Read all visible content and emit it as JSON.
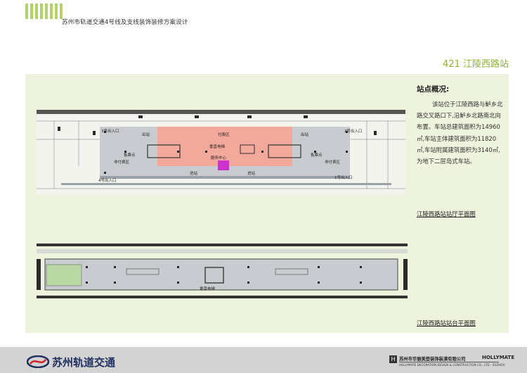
{
  "header": {
    "title": "苏州市轨道交通4号线及支线装饰装修方案设计"
  },
  "station": {
    "heading": "421  江陵西路站",
    "section_title": "站点概况:",
    "description": "该站位于江陵西路与鲈乡北路交叉路口下,沿鲈乡北路南北向布置。车站总建筑面积为14960㎡,车站主体建筑面积为11820㎡,车站附属建筑面积为3140㎡,为地下二层岛式车站。"
  },
  "plans": {
    "hall_caption": "江陵西路站站厅平面图",
    "platform_caption": "江陵西路站站台平面图",
    "hall_labels": {
      "exit3": "3号出入口",
      "exit2": "2号出入口",
      "exit4": "4号出入口",
      "exit1": "1号出入口",
      "out_left": "出站",
      "out_right": "出站",
      "paid": "付费区",
      "unpaid_left": "非付费区",
      "unpaid_right": "非付费区",
      "ticket_left": "售票点",
      "ticket_right": "售票点",
      "elevator": "垂直电梯",
      "service": "服务中心",
      "in_left": "进站",
      "in_right": "进站"
    },
    "platform_labels": {
      "elevator": "垂直电梯"
    },
    "colors": {
      "paid": "#f2a89a",
      "service": "#cc33cc",
      "floor": "#c8cbd0",
      "wall": "#2a2a2a"
    }
  },
  "footer": {
    "logo_text": "苏州轨道交通",
    "company_cn": "苏州市华丽美登装饰装潢有限公司",
    "company_brand": "HOLLYMATE",
    "company_en": "HOLLYMATE DECORATION DESIGN & CONSTRUCTION CO., LTD · SUZHOU"
  }
}
